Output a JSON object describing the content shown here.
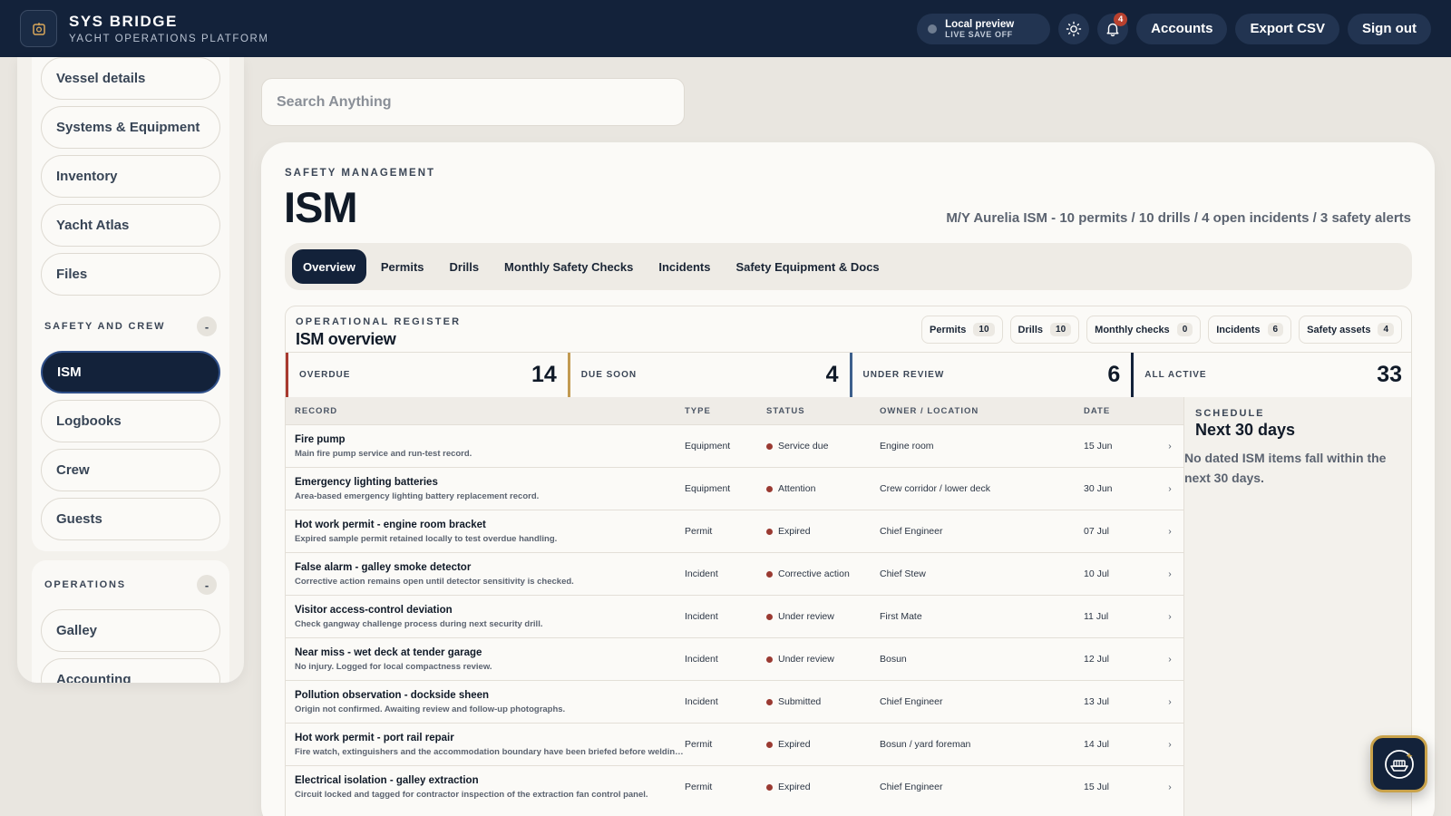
{
  "app": {
    "brand_title": "SYS BRIDGE",
    "brand_subtitle": "YACHT OPERATIONS PLATFORM"
  },
  "topbar": {
    "preview_title": "Local preview",
    "preview_status": "LIVE SAVE OFF",
    "notification_count": "4",
    "accounts_label": "Accounts",
    "export_label": "Export CSV",
    "signout_label": "Sign out"
  },
  "sidebar": {
    "group1_items": [
      "Vessel details",
      "Systems & Equipment",
      "Inventory",
      "Yacht Atlas",
      "Files"
    ],
    "group2_title": "SAFETY AND CREW",
    "group2_items": [
      "ISM",
      "Logbooks",
      "Crew",
      "Guests"
    ],
    "group3_title": "OPERATIONS",
    "group3_items": [
      "Galley",
      "Accounting"
    ],
    "collapse_label": "-"
  },
  "search": {
    "placeholder": "Search Anything"
  },
  "page": {
    "eyebrow": "SAFETY MANAGEMENT",
    "title": "ISM",
    "summary": "M/Y Aurelia ISM - 10 permits / 10 drills / 4 open incidents / 3 safety alerts"
  },
  "tabs": [
    "Overview",
    "Permits",
    "Drills",
    "Monthly Safety Checks",
    "Incidents",
    "Safety Equipment & Docs"
  ],
  "register": {
    "eyebrow": "OPERATIONAL REGISTER",
    "title": "ISM overview",
    "chips": [
      {
        "label": "Permits",
        "count": "10"
      },
      {
        "label": "Drills",
        "count": "10"
      },
      {
        "label": "Monthly checks",
        "count": "0"
      },
      {
        "label": "Incidents",
        "count": "6"
      },
      {
        "label": "Safety assets",
        "count": "4"
      }
    ],
    "stats": [
      {
        "label": "OVERDUE",
        "value": "14",
        "color": "#a8392f"
      },
      {
        "label": "DUE SOON",
        "value": "4",
        "color": "#c29a52"
      },
      {
        "label": "UNDER REVIEW",
        "value": "6",
        "color": "#3c5f8c"
      },
      {
        "label": "ALL ACTIVE",
        "value": "33",
        "color": "#13223a"
      }
    ],
    "columns": [
      "RECORD",
      "TYPE",
      "STATUS",
      "OWNER / LOCATION",
      "DATE"
    ],
    "rows": [
      {
        "title": "Fire pump",
        "sub": "Main fire pump service and run-test record.",
        "type": "Equipment",
        "status": "Service due",
        "owner": "Engine room",
        "date": "15 Jun"
      },
      {
        "title": "Emergency lighting batteries",
        "sub": "Area-based emergency lighting battery replacement record.",
        "type": "Equipment",
        "status": "Attention",
        "owner": "Crew corridor / lower deck",
        "date": "30 Jun"
      },
      {
        "title": "Hot work permit - engine room bracket",
        "sub": "Expired sample permit retained locally to test overdue handling.",
        "type": "Permit",
        "status": "Expired",
        "owner": "Chief Engineer",
        "date": "07 Jul"
      },
      {
        "title": "False alarm - galley smoke detector",
        "sub": "Corrective action remains open until detector sensitivity is checked.",
        "type": "Incident",
        "status": "Corrective action",
        "owner": "Chief Stew",
        "date": "10 Jul"
      },
      {
        "title": "Visitor access-control deviation",
        "sub": "Check gangway challenge process during next security drill.",
        "type": "Incident",
        "status": "Under review",
        "owner": "First Mate",
        "date": "11 Jul"
      },
      {
        "title": "Near miss - wet deck at tender garage",
        "sub": "No injury. Logged for local compactness review.",
        "type": "Incident",
        "status": "Under review",
        "owner": "Bosun",
        "date": "12 Jul"
      },
      {
        "title": "Pollution observation - dockside sheen",
        "sub": "Origin not confirmed. Awaiting review and follow-up photographs.",
        "type": "Incident",
        "status": "Submitted",
        "owner": "Chief Engineer",
        "date": "13 Jul"
      },
      {
        "title": "Hot work permit - port rail repair",
        "sub": "Fire watch, extinguishers and the accommodation boundary have been briefed before welding st…",
        "type": "Permit",
        "status": "Expired",
        "owner": "Bosun / yard foreman",
        "date": "14 Jul"
      },
      {
        "title": "Electrical isolation - galley extraction",
        "sub": "Circuit locked and tagged for contractor inspection of the extraction fan control panel.",
        "type": "Permit",
        "status": "Expired",
        "owner": "Chief Engineer",
        "date": "15 Jul"
      }
    ],
    "chevron": "›"
  },
  "schedule": {
    "eyebrow": "SCHEDULE",
    "title": "Next 30 days",
    "empty": "No dated ISM items fall within the next 30 days."
  }
}
